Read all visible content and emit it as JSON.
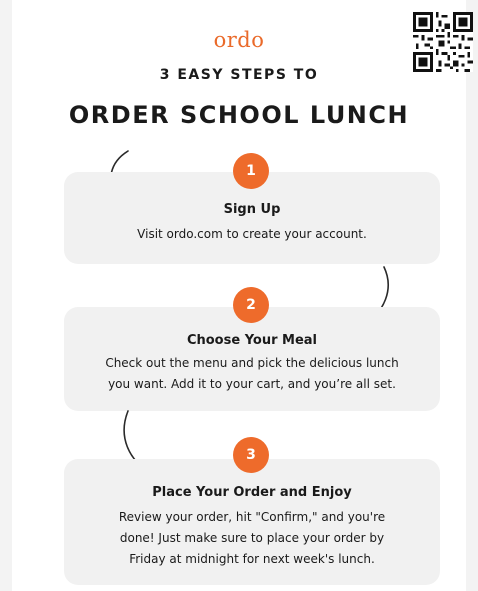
{
  "brand": {
    "logo": "ordo",
    "accent_color": "#ee6b2b"
  },
  "header": {
    "subtitle": "3 EASY STEPS TO",
    "title": "ORDER SCHOOL  LUNCH"
  },
  "qr_code": {
    "icon": "qr-code-icon"
  },
  "steps": [
    {
      "number": "1",
      "title": "Sign Up",
      "lines": [
        "Visit ordo.com to create your account."
      ]
    },
    {
      "number": "2",
      "title": "Choose Your Meal",
      "lines": [
        "Check out the menu and pick the delicious lunch",
        "you want. Add it to your cart, and you’re all set."
      ]
    },
    {
      "number": "3",
      "title": "Place Your Order and Enjoy",
      "lines": [
        "Review your order, hit \"Confirm,\" and you're",
        "done! Just make sure to place your order by",
        "Friday at midnight for next week's lunch."
      ]
    }
  ]
}
